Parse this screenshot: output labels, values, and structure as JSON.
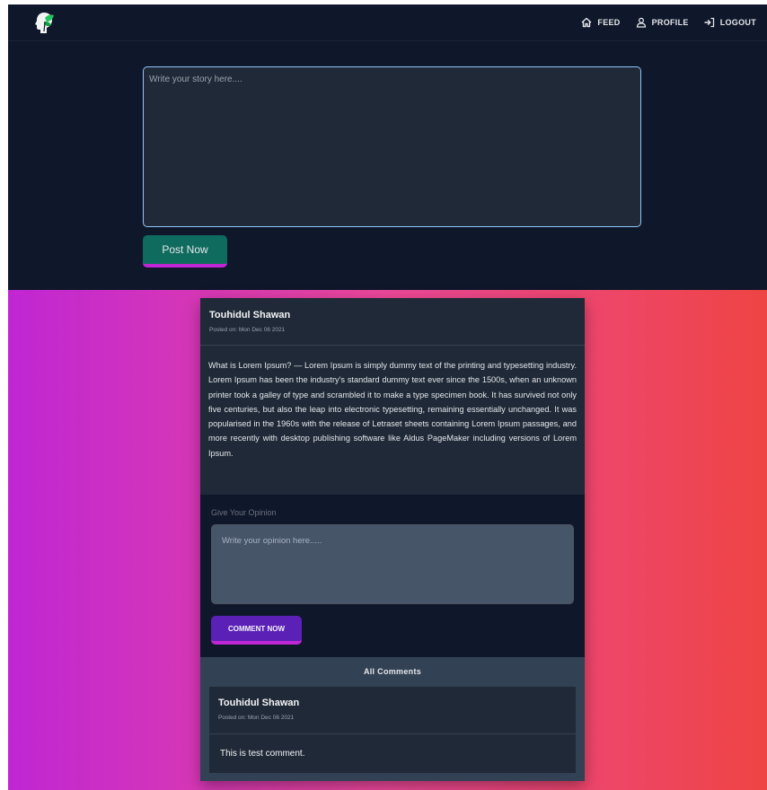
{
  "nav": {
    "feed": "FEED",
    "profile": "PROFILE",
    "logout": "LOGOUT"
  },
  "story_form": {
    "placeholder": "Write your story here....",
    "value": "",
    "submit_label": "Post Now"
  },
  "post": {
    "author": "Touhidul Shawan",
    "posted_on": "Posted on: Mon Dec 06 2021",
    "body": "What is Lorem Ipsum? — Lorem Ipsum is simply dummy text of the printing and typesetting industry. Lorem Ipsum has been the industry's standard dummy text ever since the 1500s, when an unknown printer took a galley of type and scrambled it to make a type specimen book. It has survived not only five centuries, but also the leap into electronic typesetting, remaining essentially unchanged. It was popularised in the 1960s with the release of Letraset sheets containing Lorem Ipsum passages, and more recently with desktop publishing software like Aldus PageMaker including versions of Lorem Ipsum."
  },
  "opinion_form": {
    "label": "Give Your Opinion",
    "placeholder": "Write your opinion here.....",
    "value": "",
    "submit_label": "COMMENT NOW"
  },
  "comments": {
    "title": "All Comments",
    "items": [
      {
        "author": "Touhidul Shawan",
        "posted_on": "Posted on: Mon Dec 06 2021",
        "text": "This is test comment."
      }
    ]
  },
  "icons": {
    "logo": "tree-head-logo-icon",
    "feed": "home-icon",
    "profile": "user-icon",
    "logout": "logout-icon"
  },
  "colors": {
    "dark_bg": "#0f172a",
    "card_bg": "#1f2937",
    "post_button": "#0f6b5e",
    "comment_button": "#5b21b6",
    "button_underline": "#c026d3",
    "gradient_start": "#c026d3",
    "gradient_mid": "#ec4899",
    "gradient_end": "#ef4444"
  }
}
